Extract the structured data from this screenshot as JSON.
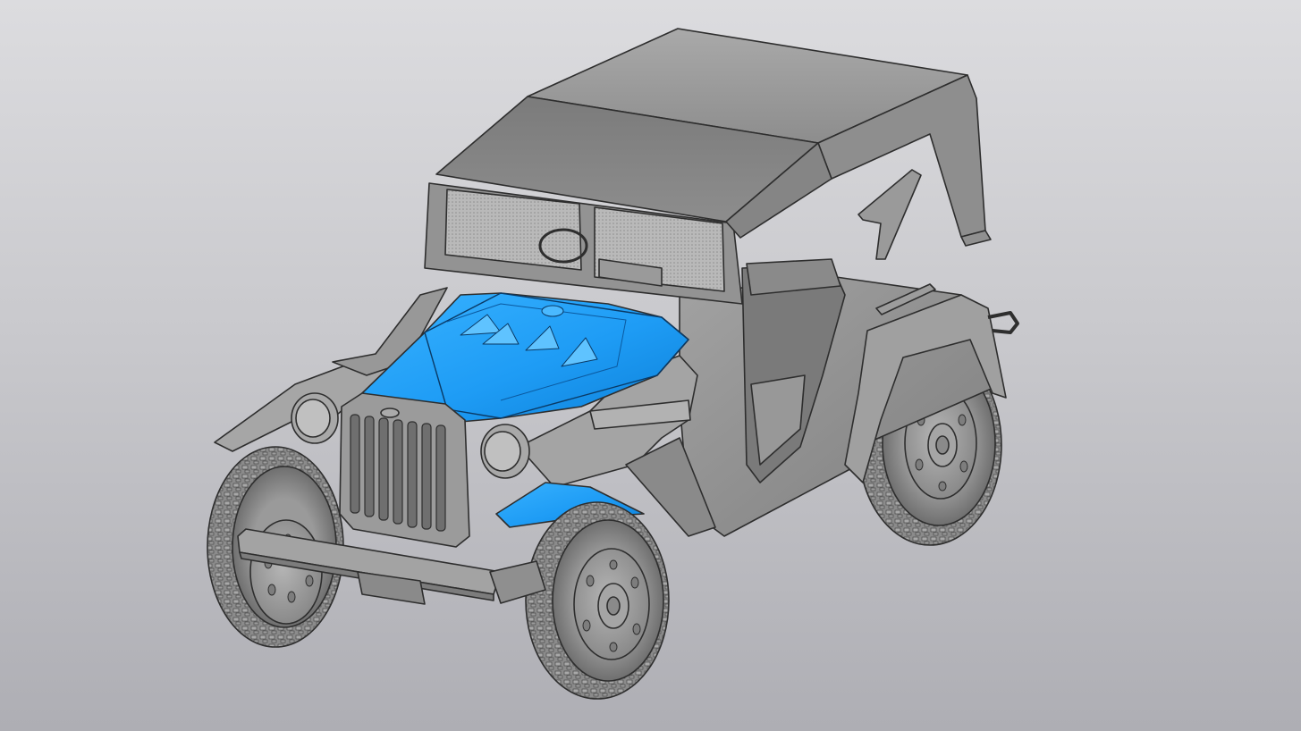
{
  "viewport": {
    "background_top": "#dcdcdf",
    "background_bottom": "#aeaeb4"
  },
  "model": {
    "body_color": "#8c8c8c",
    "highlight_color": "#1e9cf5",
    "selected_part": "hood",
    "icons": [
      "vehicle-model",
      "wheel-icon"
    ]
  }
}
